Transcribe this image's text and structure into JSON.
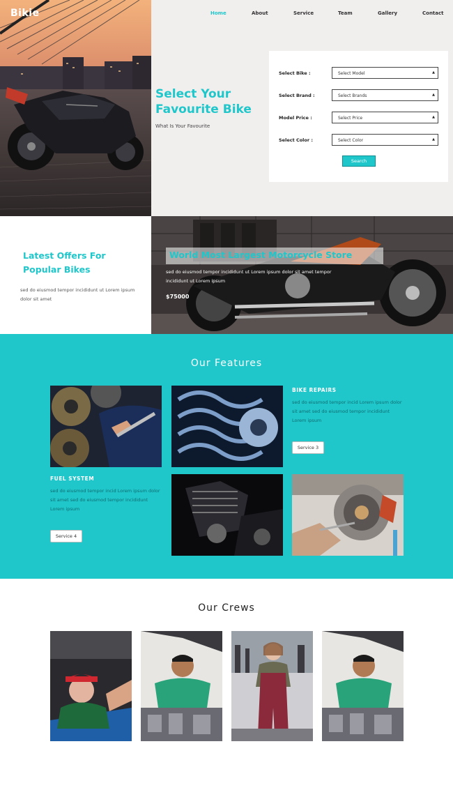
{
  "brand": "Bikie",
  "nav": [
    {
      "label": "Home",
      "active": true
    },
    {
      "label": "About",
      "active": false
    },
    {
      "label": "Service",
      "active": false
    },
    {
      "label": "Team",
      "active": false
    },
    {
      "label": "Gallery",
      "active": false
    },
    {
      "label": "Contact",
      "active": false
    }
  ],
  "hero": {
    "title": "Select Your Favourite Bike",
    "subtitle": "What Is Your Favourite"
  },
  "search_form": {
    "rows": [
      {
        "label": "Select Bike :",
        "value": "Select Model"
      },
      {
        "label": "Select Brand :",
        "value": "Select Brands"
      },
      {
        "label": "Model Price :",
        "value": "Select Price"
      },
      {
        "label": "Select Color :",
        "value": "Select Color"
      }
    ],
    "button": "Search"
  },
  "offers": {
    "title": "Latest Offers For Popular Bikes",
    "text": "sed do eiusmod tempor incididunt ut Lorem ipsum dolor sit amet"
  },
  "store": {
    "title": "World Most Largest Motorcycle Store",
    "text": "sed do eiusmod tempor incididunt ut Lorem ipsum dolor sit amet tempor incididunt ut Lorem ipsum",
    "price": "$75000"
  },
  "features": {
    "heading": "Our Features",
    "bike_repairs": {
      "title": "BIKE REPAIRS",
      "text": "sed do eiusmod tempor incid Lorem ipsum dolor sit amet sed do eiusmod tempor incididunt Lorem ipsum",
      "button": "Service 3"
    },
    "fuel_system": {
      "title": "FUEL SYSTEM",
      "text": "sed do eiusmod tempor incid Lorem ipsum dolor sit amet sed do eiusmod tempor incididunt Lorem ipsum",
      "button": "Service 4"
    }
  },
  "crews": {
    "heading": "Our Crews"
  },
  "colors": {
    "accent": "#1fc7cb",
    "hero_bg": "#f1eeee",
    "text_dark": "#222222"
  }
}
